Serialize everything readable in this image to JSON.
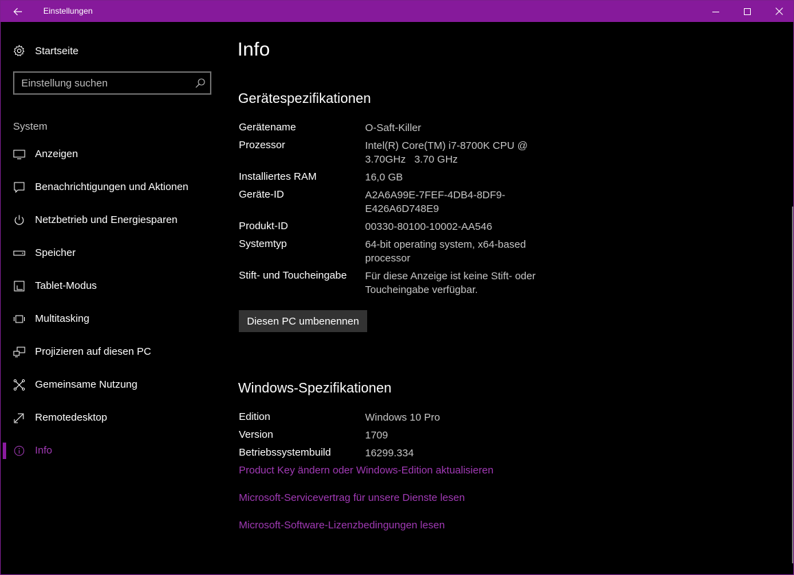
{
  "window": {
    "title": "Einstellungen"
  },
  "sidebar": {
    "home_label": "Startseite",
    "search_placeholder": "Einstellung suchen",
    "section_label": "System",
    "items": [
      {
        "label": "Anzeigen",
        "icon": "monitor-icon"
      },
      {
        "label": "Benachrichtigungen und Aktionen",
        "icon": "notification-icon"
      },
      {
        "label": "Netzbetrieb und Energiesparen",
        "icon": "power-icon"
      },
      {
        "label": "Speicher",
        "icon": "storage-icon"
      },
      {
        "label": "Tablet-Modus",
        "icon": "tablet-icon"
      },
      {
        "label": "Multitasking",
        "icon": "multitasking-icon"
      },
      {
        "label": "Projizieren auf diesen PC",
        "icon": "project-icon"
      },
      {
        "label": "Gemeinsame Nutzung",
        "icon": "share-icon"
      },
      {
        "label": "Remotedesktop",
        "icon": "remote-desktop-icon"
      },
      {
        "label": "Info",
        "icon": "info-icon",
        "active": true
      }
    ]
  },
  "main": {
    "title": "Info",
    "device_heading": "Gerätespezifikationen",
    "device_specs": [
      {
        "key": "Gerätename",
        "value": "O-Saft-Killer"
      },
      {
        "key": "Prozessor",
        "value": "Intel(R) Core(TM) i7-8700K CPU @ 3.70GHz   3.70 GHz"
      },
      {
        "key": "Installiertes RAM",
        "value": "16,0 GB"
      },
      {
        "key": "Geräte-ID",
        "value": "A2A6A99E-7FEF-4DB4-8DF9-E426A6D748E9"
      },
      {
        "key": "Produkt-ID",
        "value": "00330-80100-10002-AA546"
      },
      {
        "key": "Systemtyp",
        "value": "64-bit operating system, x64-based processor"
      },
      {
        "key": "Stift- und Toucheingabe",
        "value": "Für diese Anzeige ist keine Stift- oder Toucheingabe verfügbar."
      }
    ],
    "rename_button": "Diesen PC umbenennen",
    "windows_heading": "Windows-Spezifikationen",
    "windows_specs": [
      {
        "key": "Edition",
        "value": "Windows 10 Pro"
      },
      {
        "key": "Version",
        "value": "1709"
      },
      {
        "key": "Betriebssystembuild",
        "value": "16299.334"
      }
    ],
    "links": [
      "Product Key ändern oder Windows-Edition aktualisieren",
      "Microsoft-Servicevertrag für unsere Dienste lesen",
      "Microsoft-Software-Lizenzbedingungen lesen"
    ]
  },
  "colors": {
    "accent": "#861a9b",
    "link": "#a13ab5",
    "background": "#000000"
  }
}
